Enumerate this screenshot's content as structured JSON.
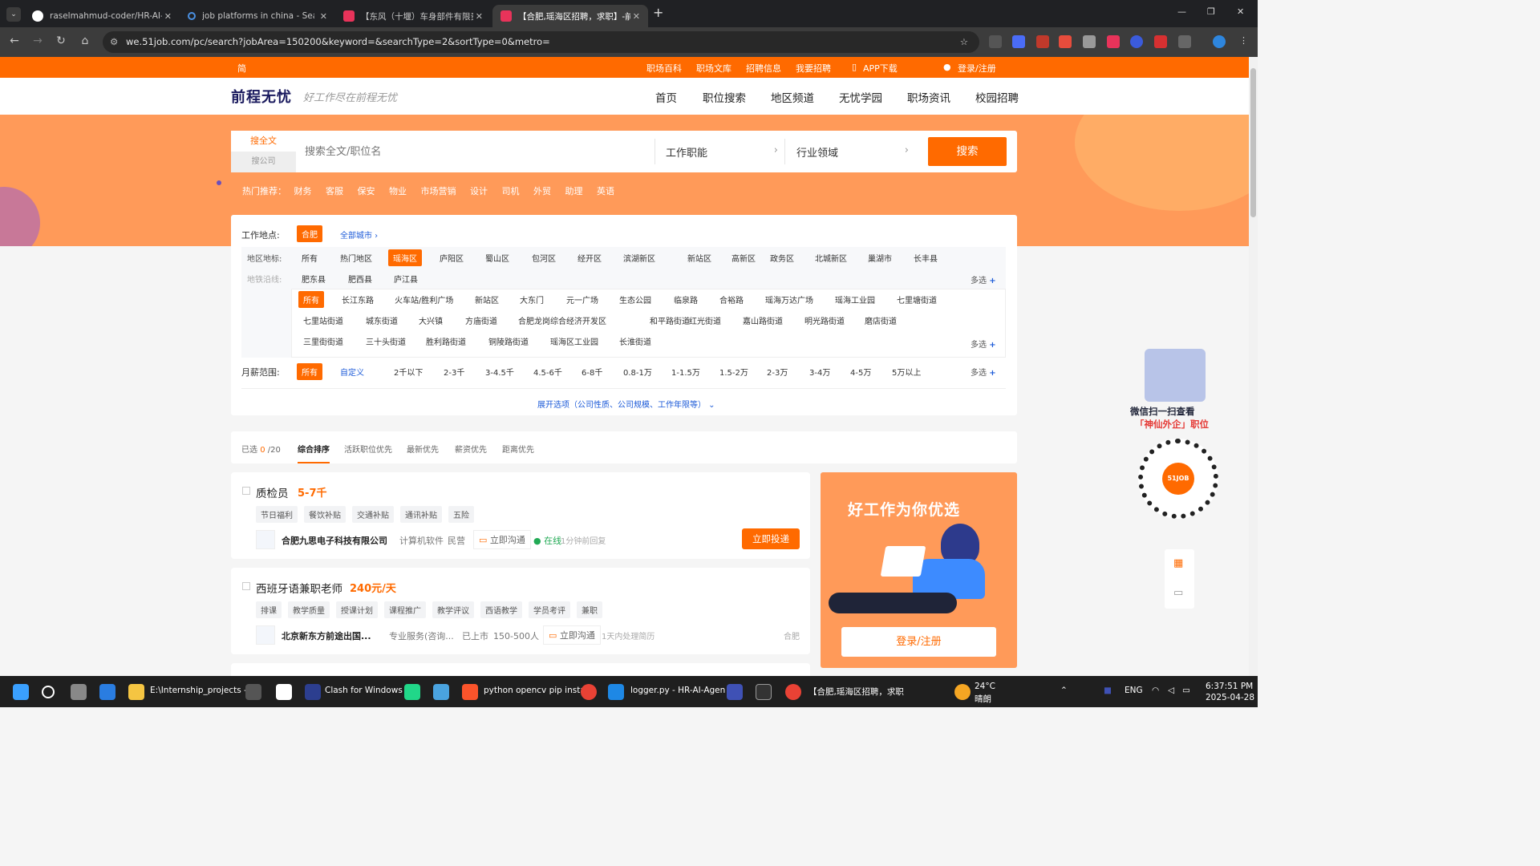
{
  "browser": {
    "tabs": [
      {
        "title": "raselmahmud-coder/HR-AI-Agent",
        "active": false
      },
      {
        "title": "job platforms in china - Search",
        "active": false
      },
      {
        "title": "【东风（十堰）车身部件有限责任…",
        "active": false
      },
      {
        "title": "【合肥,瑶海区招聘，求职】-前程…",
        "active": true
      }
    ],
    "new_tab": "+",
    "url": "we.51job.com/pc/search?jobArea=150200&keyword=&searchType=2&sortType=0&metro="
  },
  "topnav": {
    "lang": "简",
    "links": [
      "职场百科",
      "职场文库",
      "招聘信息",
      "我要招聘"
    ],
    "app": "APP下载",
    "login": "登录/注册"
  },
  "header": {
    "logo": "前程无忧",
    "slogan": "好工作尽在前程无忧",
    "nav": [
      "首页",
      "职位搜索",
      "地区频道",
      "无忧学园",
      "职场资讯",
      "校园招聘"
    ]
  },
  "search": {
    "tab_full": "搜全文",
    "tab_company": "搜公司",
    "placeholder": "搜索全文/职位名",
    "function": "工作职能",
    "industry": "行业领域",
    "button": "搜索"
  },
  "hot": {
    "label": "热门推荐：",
    "items": [
      "财务",
      "客服",
      "保安",
      "物业",
      "市场营销",
      "设计",
      "司机",
      "外贸",
      "助理",
      "英语"
    ]
  },
  "filters": {
    "location_label": "工作地点:",
    "city": "合肥",
    "all_cities": "全部城市 ›",
    "area_label": "地区地标:",
    "areas": [
      "所有",
      "热门地区",
      "瑶海区",
      "庐阳区",
      "蜀山区",
      "包河区",
      "经开区",
      "滨湖新区",
      "新站区",
      "高新区",
      "政务区",
      "北城新区",
      "巢湖市",
      "长丰县",
      "肥东县",
      "肥西县",
      "庐江县"
    ],
    "metro_label": "地铁沿线:",
    "more": "多选",
    "streets": [
      [
        "所有",
        "长江东路",
        "火车站/胜利广场",
        "新站区",
        "大东门",
        "元一广场",
        "生态公园",
        "临泉路",
        "合裕路",
        "瑶海万达广场",
        "瑶海工业园",
        "七里塘街道"
      ],
      [
        "七里站街道",
        "城东街道",
        "大兴镇",
        "方庙街道",
        "合肥龙岗综合经济开发区",
        "和平路街道",
        "红光街道",
        "嘉山路街道",
        "明光路街道",
        "磨店街道"
      ],
      [
        "三里街街道",
        "三十头街道",
        "胜利路街道",
        "铜陵路街道",
        "瑶海区工业园",
        "长淮街道"
      ]
    ],
    "salary_label": "月薪范围:",
    "salaries": [
      "所有",
      "自定义",
      "2千以下",
      "2-3千",
      "3-4.5千",
      "4.5-6千",
      "6-8千",
      "0.8-1万",
      "1-1.5万",
      "1.5-2万",
      "2-3万",
      "3-4万",
      "4-5万",
      "5万以上"
    ],
    "expand": "展开选项（公司性质、公司规模、工作年限等）"
  },
  "sort": {
    "selected_prefix": "已选",
    "selected_count": "0",
    "selected_total": "/20",
    "options": [
      "综合排序",
      "活跃职位优先",
      "最新优先",
      "薪资优先",
      "距离优先"
    ]
  },
  "jobs": [
    {
      "title": "质检员",
      "salary": "5-7千",
      "tags": [
        "节日福利",
        "餐饮补贴",
        "交通补贴",
        "通讯补贴",
        "五险"
      ],
      "company": "合肥九思电子科技有限公司",
      "industry": "计算机软件",
      "type": "民营",
      "chat": "立即沟通",
      "status": "在线",
      "reply": "1分钟前回复",
      "apply": "立即投递",
      "city": ""
    },
    {
      "title": "西班牙语兼职老师",
      "salary": "240元/天",
      "tags": [
        "排课",
        "教学质量",
        "授课计划",
        "课程推广",
        "教学评议",
        "西语教学",
        "学员考评",
        "兼职"
      ],
      "company": "北京新东方前途出国...",
      "industry": "专业服务(咨询...",
      "type": "已上市",
      "size": "150-500人",
      "chat": "立即沟通",
      "reply": "1天内处理简历",
      "city": "合肥"
    }
  ],
  "ad": {
    "headline": "好工作为你优选",
    "login": "登录/注册"
  },
  "qr": {
    "line1": "微信扫一扫查看",
    "line2": "「神仙外企」职位",
    "brand": "51JOB"
  },
  "taskbar": {
    "items": [
      "E:\\Internship_projects -",
      "Clash for Windows",
      "python opencv pip insta",
      "logger.py - HR-AI-Agen",
      "【合肥,瑶海区招聘，求职"
    ],
    "weather_temp": "24°C",
    "weather_desc": "晴朗",
    "lang": "ENG",
    "time": "6:37:51 PM",
    "date": "2025-04-28"
  },
  "colors": {
    "brand": "#ff6a00",
    "hero": "#ff9a59",
    "navy": "#1a1a5e"
  }
}
